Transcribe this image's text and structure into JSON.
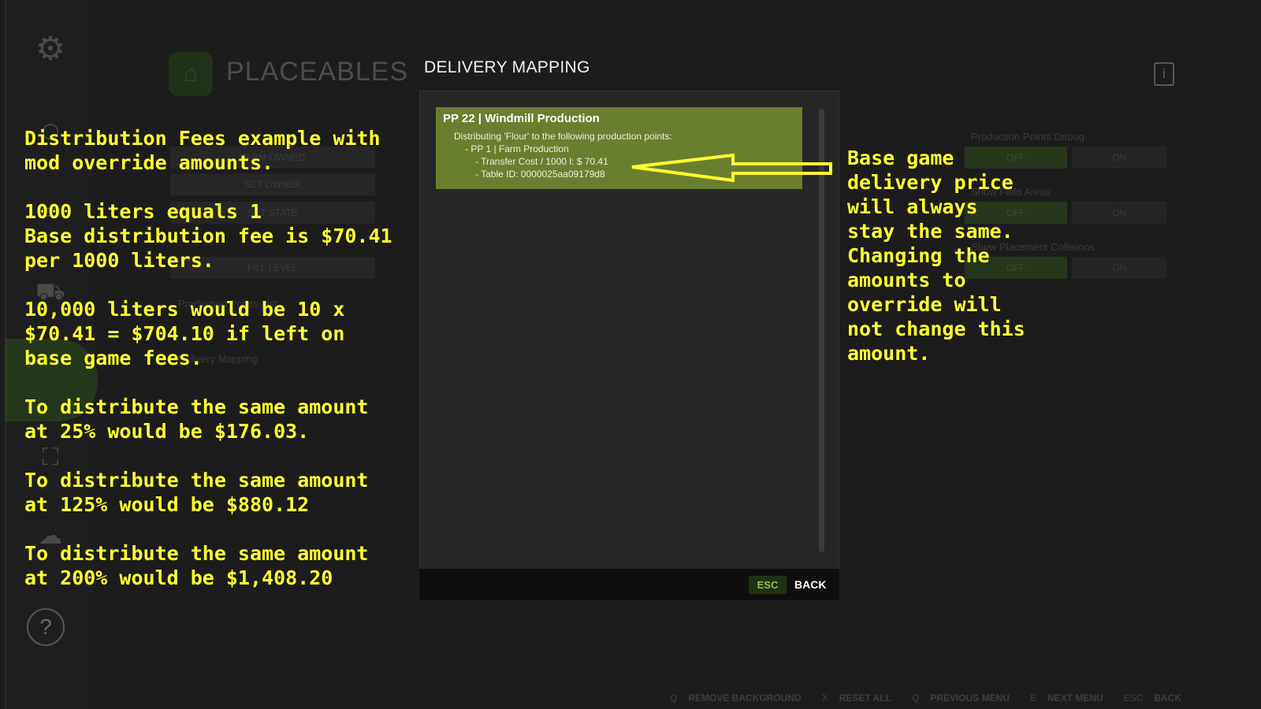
{
  "background": {
    "page_title": "PLACEABLES",
    "rows": {
      "farm_owned": "FARM OWNED",
      "set_owner": "SET OWNER",
      "set_state": "SET STATE",
      "fill_level": "FILL LEVEL",
      "production_points_list": "Production Points List",
      "delivery_mapping": "Delivery Mapping",
      "production_points_debug": "Production Points Debug",
      "show_field_areas": "Show Field Areas",
      "show_placement_collisions": "Show Placement Collisions",
      "off": "OFF",
      "on": "ON"
    },
    "footer": [
      {
        "key": "Q",
        "label": "REMOVE BACKGROUND"
      },
      {
        "key": "X",
        "label": "RESET ALL"
      },
      {
        "key": "Q",
        "label": "PREVIOUS MENU"
      },
      {
        "key": "E",
        "label": "NEXT MENU"
      },
      {
        "key": "ESC",
        "label": "BACK"
      }
    ]
  },
  "dialog": {
    "title": "DELIVERY MAPPING",
    "entry": {
      "title": "PP 22  | Windmill Production",
      "line1": "Distributing 'Flour' to the following production points:",
      "line2": "- PP 1  |  Farm Production",
      "line3": "- Transfer Cost / 1000 l:  $ 70.41",
      "line4": "- Table ID:  0000025aa09179d8"
    },
    "esc_key": "ESC",
    "back_label": "BACK"
  },
  "annotations": {
    "left_text": "Distribution Fees example with\nmod override amounts.\n\n1000 liters equals 1\nBase distribution fee is $70.41\nper 1000 liters.\n\n10,000 liters would be 10 x\n$70.41 = $704.10 if left on\nbase game fees.\n\nTo distribute the same amount\nat 25% would be $176.03.\n\nTo distribute the same amount\nat 125% would be $880.12\n\nTo distribute the same amount\nat 200% would be $1,408.20",
    "right_text": "Base game\ndelivery price\nwill always\nstay the same.\nChanging the\namounts to\noverride will\nnot change this\namount.",
    "arrow_color": "#ffff33"
  }
}
